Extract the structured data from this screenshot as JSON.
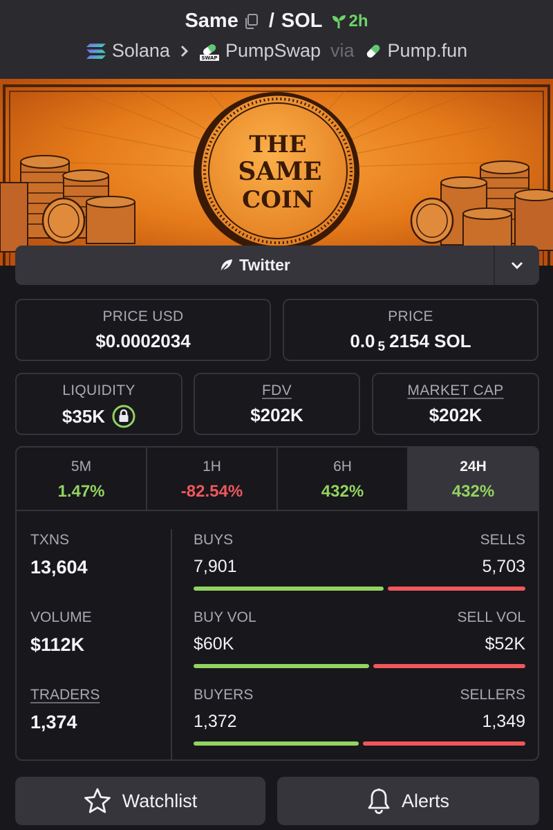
{
  "header": {
    "token": "Same",
    "separator": "/",
    "quote": "SOL",
    "age": "2h",
    "chain": "Solana",
    "dex": "PumpSwap",
    "via": "via",
    "launchpad": "Pump.fun"
  },
  "banner": {
    "coin_line1": "THE",
    "coin_line2": "SAME",
    "coin_line3": "COIN"
  },
  "social": {
    "label": "Twitter"
  },
  "prices": {
    "usd_label": "PRICE USD",
    "usd_value": "$0.0002034",
    "native_label": "PRICE",
    "native_prefix": "0.0",
    "native_zeros": "5",
    "native_suffix": "2154 SOL"
  },
  "stats": {
    "liquidity_label": "LIQUIDITY",
    "liquidity_value": "$35K",
    "fdv_label": "FDV",
    "fdv_value": "$202K",
    "mcap_label": "MARKET CAP",
    "mcap_value": "$202K"
  },
  "periods": [
    {
      "label": "5M",
      "change": "1.47%",
      "direction": "up"
    },
    {
      "label": "1H",
      "change": "-82.54%",
      "direction": "down"
    },
    {
      "label": "6H",
      "change": "432%",
      "direction": "up"
    },
    {
      "label": "24H",
      "change": "432%",
      "direction": "up",
      "selected": true
    }
  ],
  "metrics": {
    "txns_label": "TXNS",
    "txns_value": "13,604",
    "volume_label": "VOLUME",
    "volume_value": "$112K",
    "traders_label": "TRADERS",
    "traders_value": "1,374",
    "buys_label": "BUYS",
    "buys_value": "7,901",
    "sells_label": "SELLS",
    "sells_value": "5,703",
    "buy_vol_label": "BUY VOL",
    "buy_vol_value": "$60K",
    "sell_vol_label": "SELL VOL",
    "sell_vol_value": "$52K",
    "buyers_label": "BUYERS",
    "buyers_value": "1,372",
    "sellers_label": "SELLERS",
    "sellers_value": "1,349"
  },
  "ratios": {
    "buys_share": 0.581,
    "buy_vol_share": 0.536,
    "buyers_share": 0.504
  },
  "actions": {
    "watchlist": "Watchlist",
    "alerts": "Alerts"
  },
  "colors": {
    "positive": "#93d35f",
    "negative": "#f0575a",
    "age_green": "#6fd36a",
    "banner_orange": "#e8801e"
  }
}
